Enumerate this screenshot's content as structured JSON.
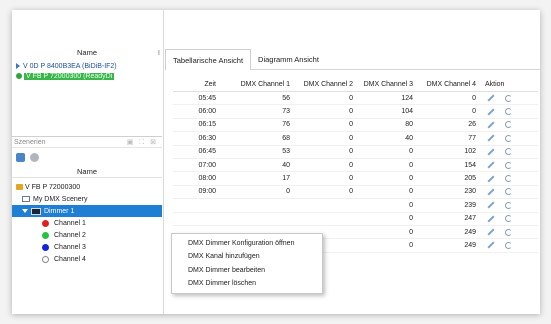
{
  "devices": {
    "header": "Name",
    "header_tick": "I",
    "rows": [
      {
        "label": "V 0D P 8400B3EA (BiDiB-IF2)"
      },
      {
        "label": "V FB P 72000300 (ReadyDi"
      }
    ]
  },
  "scenes": {
    "title": "Szenerien",
    "name_header": "Name",
    "tree": [
      {
        "label": "V FB P 72000300",
        "level": 1,
        "icon": "key-icon"
      },
      {
        "label": "My DMX Scenery",
        "level": 2,
        "icon": "scene-icon"
      },
      {
        "label": "Dimmer 1",
        "level": 2,
        "icon": "dimmer-icon",
        "selected": true
      },
      {
        "label": "Channel 1",
        "level": 3,
        "color": "#e02020"
      },
      {
        "label": "Channel 2",
        "level": 3,
        "color": "#28c040"
      },
      {
        "label": "Channel 3",
        "level": 3,
        "color": "#1525d8"
      },
      {
        "label": "Channel 4",
        "level": 3,
        "color": "#ffffff"
      }
    ]
  },
  "tabs": [
    {
      "label": "Tabellarische Ansicht",
      "active": true
    },
    {
      "label": "Diagramm Ansicht",
      "active": false
    }
  ],
  "table": {
    "headers": [
      "Zeit",
      "DMX Channel 1",
      "DMX Channel 2",
      "DMX Channel 3",
      "DMX Channel 4",
      "Aktion"
    ],
    "rows": [
      [
        "05:45",
        "56",
        "0",
        "124",
        "0"
      ],
      [
        "06:00",
        "73",
        "0",
        "104",
        "0"
      ],
      [
        "06:15",
        "76",
        "0",
        "80",
        "26"
      ],
      [
        "06:30",
        "68",
        "0",
        "40",
        "77"
      ],
      [
        "06:45",
        "53",
        "0",
        "0",
        "102"
      ],
      [
        "07:00",
        "40",
        "0",
        "0",
        "154"
      ],
      [
        "08:00",
        "17",
        "0",
        "0",
        "205"
      ],
      [
        "09:00",
        "0",
        "0",
        "0",
        "230"
      ],
      [
        "",
        "",
        "",
        "0",
        "239"
      ],
      [
        "",
        "",
        "",
        "0",
        "247"
      ],
      [
        "",
        "",
        "",
        "0",
        "249"
      ],
      [
        "",
        "",
        "",
        "0",
        "249"
      ]
    ]
  },
  "context_menu": {
    "items": [
      "DMX Dimmer Konfiguration öffnen",
      "DMX Kanal hinzufügen",
      "DMX Dimmer bearbeiten",
      "DMX Dimmer löschen"
    ]
  }
}
